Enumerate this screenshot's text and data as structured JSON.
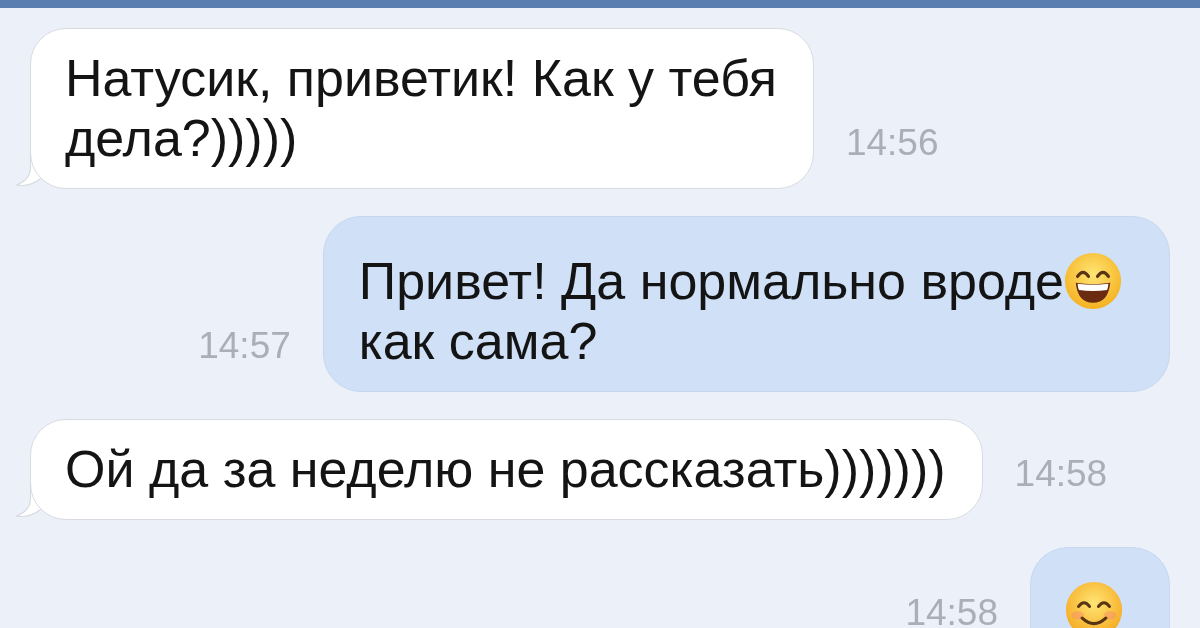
{
  "messages": [
    {
      "kind": "incoming",
      "lines": [
        {
          "parts": [
            {
              "kind": "text",
              "text": "Натусик, приветик! Как у тебя"
            }
          ]
        },
        {
          "parts": [
            {
              "kind": "text",
              "text": "дела?)))))"
            }
          ]
        }
      ],
      "time": "14:56"
    },
    {
      "kind": "outgoing",
      "lines": [
        {
          "parts": [
            {
              "kind": "text",
              "text": "Привет! Да нормально вроде"
            },
            {
              "kind": "grin"
            }
          ]
        },
        {
          "parts": [
            {
              "kind": "text",
              "text": "как сама?"
            }
          ]
        }
      ],
      "time": "14:57"
    },
    {
      "kind": "incoming",
      "lines": [
        {
          "parts": [
            {
              "kind": "text",
              "text": "Ой да за неделю не рассказать)))))))"
            }
          ]
        }
      ],
      "time": "14:58"
    },
    {
      "kind": "outgoing",
      "lines": [
        {
          "parts": [
            {
              "kind": "smile"
            }
          ]
        }
      ],
      "time": "14:58"
    }
  ]
}
